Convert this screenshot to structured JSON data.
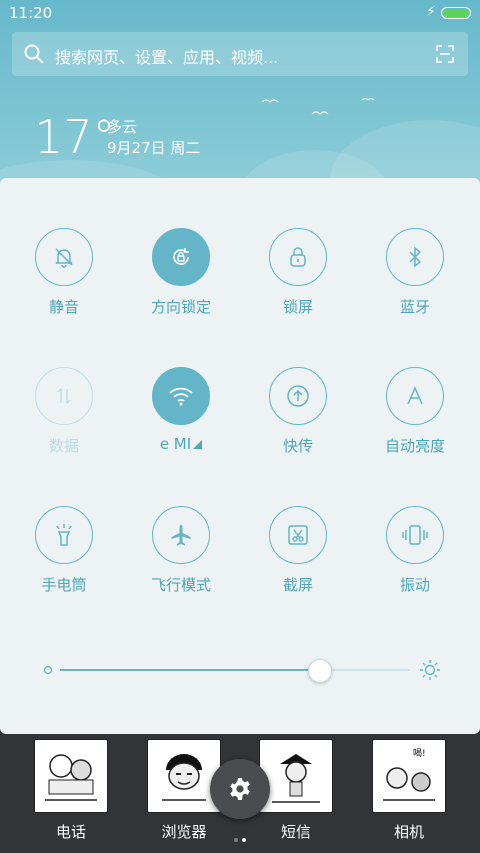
{
  "status": {
    "time": "11:20"
  },
  "search": {
    "placeholder": "搜索网页、设置、应用、视频..."
  },
  "weather": {
    "temperature": "17°",
    "condition": "多云",
    "date": "9月27日 周二"
  },
  "quick_toggles": [
    {
      "label": "静音",
      "icon": "bell-off-icon",
      "state": "off"
    },
    {
      "label": "方向锁定",
      "icon": "rotation-lock-icon",
      "state": "on"
    },
    {
      "label": "锁屏",
      "icon": "lock-icon",
      "state": "off"
    },
    {
      "label": "蓝牙",
      "icon": "bluetooth-icon",
      "state": "off"
    },
    {
      "label": "数据",
      "icon": "data-arrows-icon",
      "state": "disabled"
    },
    {
      "label": "e MI",
      "icon": "wifi-icon",
      "state": "on"
    },
    {
      "label": "快传",
      "icon": "upload-icon",
      "state": "off"
    },
    {
      "label": "自动亮度",
      "icon": "auto-brightness-icon",
      "state": "off"
    },
    {
      "label": "手电筒",
      "icon": "flashlight-icon",
      "state": "off"
    },
    {
      "label": "飞行模式",
      "icon": "airplane-icon",
      "state": "off"
    },
    {
      "label": "截屏",
      "icon": "screenshot-icon",
      "state": "off"
    },
    {
      "label": "振动",
      "icon": "vibrate-icon",
      "state": "off"
    }
  ],
  "brightness": {
    "level": 0.74
  },
  "dock": [
    {
      "label": "电话"
    },
    {
      "label": "浏览器"
    },
    {
      "label": "短信"
    },
    {
      "label": "相机",
      "sticker_text": "喝!"
    }
  ],
  "colors": {
    "accent": "#63b5c7",
    "header": "#7cc4d2",
    "panel": "#edf3f5",
    "dock": "#333437"
  }
}
